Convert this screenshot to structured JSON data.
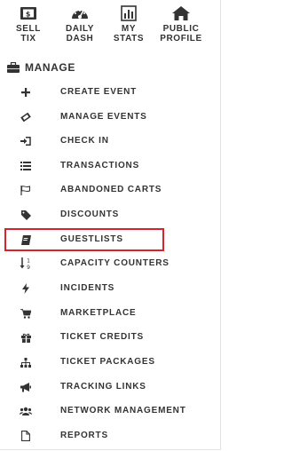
{
  "top_nav": [
    {
      "id": "sell",
      "label": "SELL\nTIX",
      "icon": "ticket-icon"
    },
    {
      "id": "dash",
      "label": "DAILY\nDASH",
      "icon": "dashboard-gauge-icon"
    },
    {
      "id": "stats",
      "label": "MY\nSTATS",
      "icon": "bar-chart-icon"
    },
    {
      "id": "profile",
      "label": "PUBLIC\nPROFILE",
      "icon": "home-icon"
    }
  ],
  "section": {
    "title": "MANAGE",
    "icon": "briefcase-icon"
  },
  "menu": [
    {
      "label": "CREATE EVENT",
      "icon": "plus-icon"
    },
    {
      "label": "MANAGE EVENTS",
      "icon": "tickets-icon"
    },
    {
      "label": "CHECK IN",
      "icon": "sign-in-icon"
    },
    {
      "label": "TRANSACTIONS",
      "icon": "list-icon"
    },
    {
      "label": "ABANDONED CARTS",
      "icon": "flag-icon"
    },
    {
      "label": "DISCOUNTS",
      "icon": "tag-icon"
    },
    {
      "label": "GUESTLISTS",
      "icon": "book-icon"
    },
    {
      "label": "CAPACITY COUNTERS",
      "icon": "sort-numeric-icon"
    },
    {
      "label": "INCIDENTS",
      "icon": "bolt-icon"
    },
    {
      "label": "MARKETPLACE",
      "icon": "cart-icon"
    },
    {
      "label": "TICKET CREDITS",
      "icon": "gift-icon"
    },
    {
      "label": "TICKET PACKAGES",
      "icon": "sitemap-icon"
    },
    {
      "label": "TRACKING LINKS",
      "icon": "bullhorn-icon"
    },
    {
      "label": "NETWORK MANAGEMENT",
      "icon": "users-icon"
    },
    {
      "label": "REPORTS",
      "icon": "file-icon"
    }
  ],
  "highlighted_item": "GUESTLISTS",
  "colors": {
    "text": "#333333",
    "highlight_border": "#d9232a",
    "background": "#ffffff"
  }
}
